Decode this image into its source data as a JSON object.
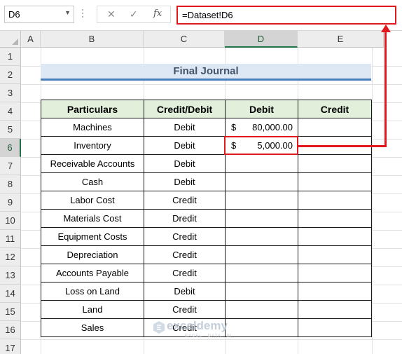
{
  "formula_bar": {
    "name_box": "D6",
    "cancel_icon": "✕",
    "enter_icon": "✓",
    "fx_label": "fx",
    "formula": "=Dataset!D6"
  },
  "columns": [
    "A",
    "B",
    "C",
    "D",
    "E"
  ],
  "selected_column": "D",
  "rows": [
    "1",
    "2",
    "3",
    "4",
    "5",
    "6",
    "7",
    "8",
    "9",
    "10",
    "11",
    "12",
    "13",
    "14",
    "15",
    "16",
    "17"
  ],
  "selected_row": "6",
  "sheet": {
    "title": "Final Journal",
    "headers": [
      "Particulars",
      "Credit/Debit",
      "Debit",
      "Credit"
    ],
    "rows": [
      {
        "particulars": "Machines",
        "type": "Debit",
        "currency": "$",
        "debit": "80,000.00",
        "credit": ""
      },
      {
        "particulars": "Inventory",
        "type": "Debit",
        "currency": "$",
        "debit": "5,000.00",
        "credit": ""
      },
      {
        "particulars": "Receivable Accounts",
        "type": "Debit",
        "currency": "",
        "debit": "",
        "credit": ""
      },
      {
        "particulars": "Cash",
        "type": "Debit",
        "currency": "",
        "debit": "",
        "credit": ""
      },
      {
        "particulars": "Labor Cost",
        "type": "Credit",
        "currency": "",
        "debit": "",
        "credit": ""
      },
      {
        "particulars": "Materials Cost",
        "type": "Dredit",
        "currency": "",
        "debit": "",
        "credit": ""
      },
      {
        "particulars": "Equipment Costs",
        "type": "Credit",
        "currency": "",
        "debit": "",
        "credit": ""
      },
      {
        "particulars": "Depreciation",
        "type": "Credit",
        "currency": "",
        "debit": "",
        "credit": ""
      },
      {
        "particulars": "Accounts Payable",
        "type": "Credit",
        "currency": "",
        "debit": "",
        "credit": ""
      },
      {
        "particulars": "Loss on Land",
        "type": "Debit",
        "currency": "",
        "debit": "",
        "credit": ""
      },
      {
        "particulars": "Land",
        "type": "Credit",
        "currency": "",
        "debit": "",
        "credit": ""
      },
      {
        "particulars": "Sales",
        "type": "Credit",
        "currency": "",
        "debit": "",
        "credit": ""
      }
    ]
  },
  "watermark": {
    "name": "exceldemy",
    "tagline": "EXCEL · DATA · BI"
  },
  "colors": {
    "accent_red": "#e0191f",
    "header_green": "#e2efda",
    "title_blue": "#dde8f4",
    "excel_green": "#217346"
  }
}
